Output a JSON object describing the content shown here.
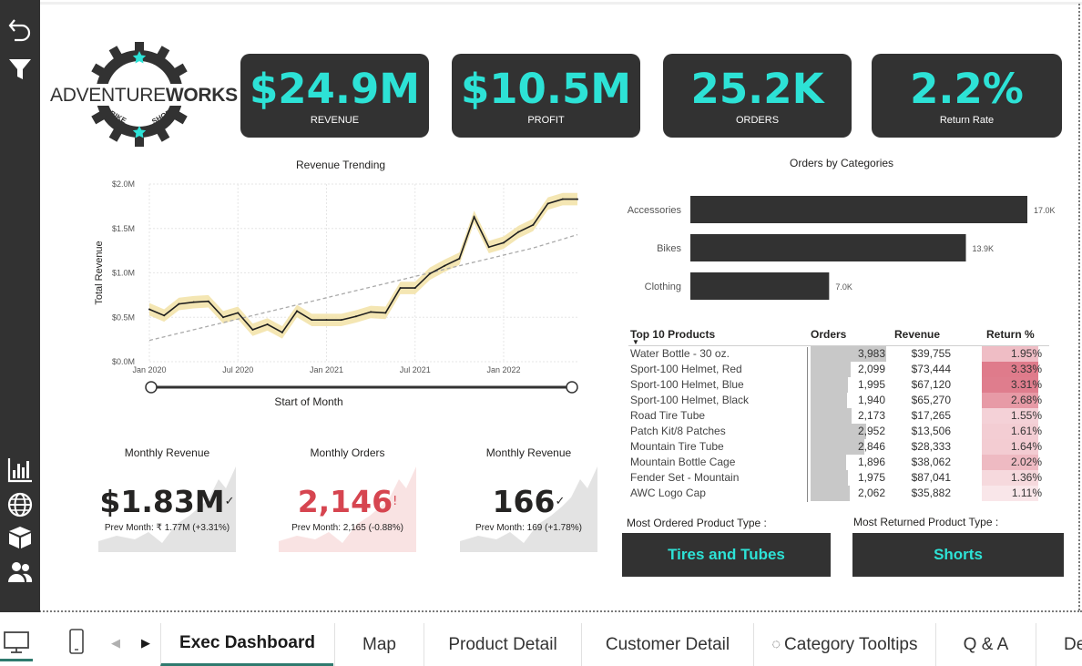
{
  "kpis": [
    {
      "value": "$24.9M",
      "label": "REVENUE"
    },
    {
      "value": "$10.5M",
      "label": "PROFIT"
    },
    {
      "value": "25.2K",
      "label": "ORDERS"
    },
    {
      "value": "2.2%",
      "label": "Return Rate"
    }
  ],
  "logo": {
    "text_main": "ADVENTURE",
    "text_bold": "WORKS",
    "text_left": "BIKE",
    "text_right": "SHOP"
  },
  "chart_data": [
    {
      "type": "line",
      "title": "Revenue Trending",
      "xlabel": "Start of Month",
      "ylabel": "Total Revenue",
      "y_ticks": [
        "$0.0M",
        "$0.5M",
        "$1.0M",
        "$1.5M",
        "$2.0M"
      ],
      "x_ticks": [
        "Jan 2020",
        "Jul 2020",
        "Jan 2021",
        "Jul 2021",
        "Jan 2022"
      ],
      "ylim": [
        0,
        2.0
      ],
      "x": [
        "2020-01",
        "2020-02",
        "2020-03",
        "2020-04",
        "2020-05",
        "2020-06",
        "2020-07",
        "2020-08",
        "2020-09",
        "2020-10",
        "2020-11",
        "2020-12",
        "2021-01",
        "2021-02",
        "2021-03",
        "2021-04",
        "2021-05",
        "2021-06",
        "2021-07",
        "2021-08",
        "2021-09",
        "2021-10",
        "2021-11",
        "2021-12",
        "2022-01",
        "2022-02",
        "2022-03",
        "2022-04",
        "2022-05",
        "2022-06"
      ],
      "series": [
        {
          "values": [
            0.59,
            0.52,
            0.65,
            0.67,
            0.68,
            0.5,
            0.55,
            0.36,
            0.42,
            0.33,
            0.57,
            0.47,
            0.47,
            0.47,
            0.51,
            0.56,
            0.55,
            0.83,
            0.83,
            0.99,
            1.08,
            1.16,
            1.63,
            1.29,
            1.34,
            1.46,
            1.54,
            1.78,
            1.83,
            1.83
          ]
        },
        {
          "values": [
            0.24,
            0.28,
            0.32,
            0.36,
            0.4,
            0.44,
            0.48,
            0.52,
            0.56,
            0.6,
            0.64,
            0.68,
            0.72,
            0.76,
            0.8,
            0.84,
            0.88,
            0.92,
            0.96,
            1.0,
            1.04,
            1.08,
            1.12,
            1.16,
            1.2,
            1.24,
            1.28,
            1.33,
            1.38,
            1.43
          ]
        }
      ]
    },
    {
      "type": "bar",
      "title": "Orders by Categories",
      "categories": [
        "Accessories",
        "Bikes",
        "Clothing"
      ],
      "values": [
        17.0,
        13.9,
        7.0
      ],
      "data_labels": [
        "17.0K",
        "13.9K",
        "7.0K"
      ],
      "xlim": [
        0,
        17.7
      ]
    }
  ],
  "cards": [
    {
      "title": "Monthly Revenue",
      "value": "$1.83M",
      "mark": "✓",
      "sub": "Prev Month: ₹ 1.77M (+3.31%)",
      "color": "#252423",
      "bg": "#dcdcdc"
    },
    {
      "title": "Monthly Orders",
      "value": "2,146",
      "mark": "!",
      "sub": "Prev Month: 2,165 (-0.88%)",
      "color": "#d64550",
      "bg": "#f8dcdc"
    },
    {
      "title": "Monthly Revenue",
      "value": "166",
      "mark": "✓",
      "sub": "Prev Month: 169 (+1.78%)",
      "color": "#252423",
      "bg": "#dcdcdc"
    }
  ],
  "table": {
    "headers": {
      "product": "Top 10 Products",
      "orders": "Orders",
      "revenue": "Revenue",
      "return": "Return %"
    },
    "sort_icon": "▼",
    "rows": [
      {
        "product": "Water Bottle - 30 oz.",
        "orders": "3,983",
        "orders_n": 3983,
        "revenue": "$39,755",
        "ret": "1.95%",
        "ret_n": 1.95
      },
      {
        "product": "Sport-100 Helmet, Red",
        "orders": "2,099",
        "orders_n": 2099,
        "revenue": "$73,444",
        "ret": "3.33%",
        "ret_n": 3.33
      },
      {
        "product": "Sport-100 Helmet, Blue",
        "orders": "1,995",
        "orders_n": 1995,
        "revenue": "$67,120",
        "ret": "3.31%",
        "ret_n": 3.31
      },
      {
        "product": "Sport-100 Helmet, Black",
        "orders": "1,940",
        "orders_n": 1940,
        "revenue": "$65,270",
        "ret": "2.68%",
        "ret_n": 2.68
      },
      {
        "product": "Road Tire Tube",
        "orders": "2,173",
        "orders_n": 2173,
        "revenue": "$17,265",
        "ret": "1.55%",
        "ret_n": 1.55
      },
      {
        "product": "Patch Kit/8 Patches",
        "orders": "2,952",
        "orders_n": 2952,
        "revenue": "$13,506",
        "ret": "1.61%",
        "ret_n": 1.61
      },
      {
        "product": "Mountain Tire Tube",
        "orders": "2,846",
        "orders_n": 2846,
        "revenue": "$28,333",
        "ret": "1.64%",
        "ret_n": 1.64
      },
      {
        "product": "Mountain Bottle Cage",
        "orders": "1,896",
        "orders_n": 1896,
        "revenue": "$38,062",
        "ret": "2.02%",
        "ret_n": 2.02
      },
      {
        "product": "Fender Set - Mountain",
        "orders": "1,975",
        "orders_n": 1975,
        "revenue": "$87,041",
        "ret": "1.36%",
        "ret_n": 1.36
      },
      {
        "product": "AWC Logo Cap",
        "orders": "2,062",
        "orders_n": 2062,
        "revenue": "$35,882",
        "ret": "1.11%",
        "ret_n": 1.11
      }
    ]
  },
  "most_ordered": {
    "label": "Most Ordered Product Type :",
    "value": "Tires and Tubes"
  },
  "most_returned": {
    "label": "Most Returned Product Type :",
    "value": "Shorts"
  },
  "tabs": [
    "Exec Dashboard",
    "Map",
    "Product Detail",
    "Customer Detail",
    "Category Tooltips",
    "Q & A",
    "De"
  ],
  "active_tab": "Exec Dashboard",
  "colors": {
    "accent": "#2de2d6",
    "dark": "#323232",
    "negative": "#d64550",
    "band": "#f2e2a6"
  }
}
